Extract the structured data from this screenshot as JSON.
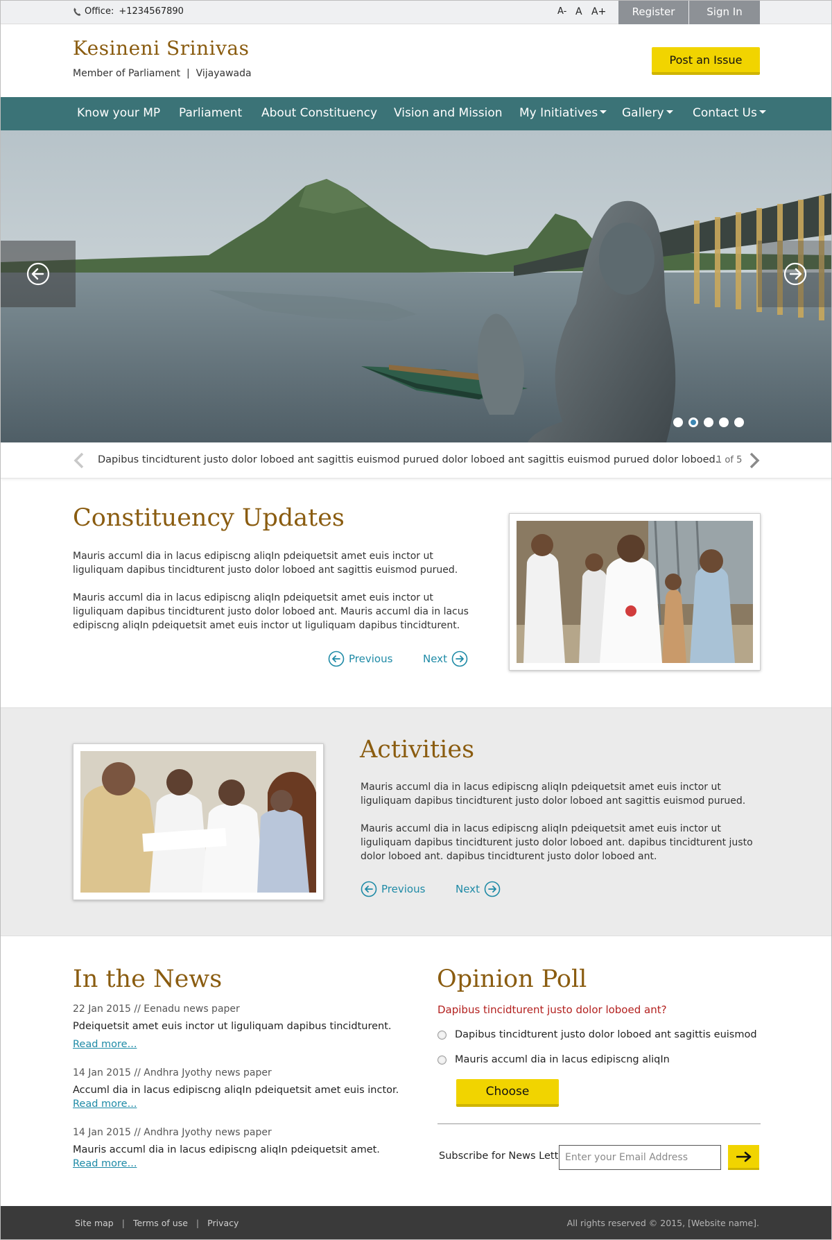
{
  "topbar": {
    "office_label": "Office:",
    "office_phone": "+1234567890",
    "font_decrease": "A-",
    "font_normal": "A",
    "font_increase": "A+",
    "register": "Register",
    "sign_in": "Sign In"
  },
  "header": {
    "title": "Kesineni Srinivas",
    "subtitle": "Member of Parliament  |  Vijayawada",
    "post_issue": "Post an Issue"
  },
  "nav": {
    "items": [
      {
        "label": "Know your MP",
        "dropdown": false
      },
      {
        "label": "Parliament",
        "dropdown": false
      },
      {
        "label": "About Constituency",
        "dropdown": false
      },
      {
        "label": "Vision and Mission",
        "dropdown": false
      },
      {
        "label": "My Initiatives",
        "dropdown": true
      },
      {
        "label": "Gallery",
        "dropdown": true
      },
      {
        "label": "Contact Us",
        "dropdown": true
      }
    ]
  },
  "slider": {
    "slide_count": 5,
    "active_slide": 2,
    "caption": "Dapibus tincidturent justo dolor loboed ant sagittis euismod purued dolor loboed ant sagittis euismod purued dolor loboed.",
    "counter": "1 of 5"
  },
  "updates": {
    "title": "Constituency Updates",
    "para1": "Mauris accuml dia in lacus edipiscng aliqIn pdeiquetsit amet euis inctor ut liguliquam dapibus tincidturent justo dolor loboed ant sagittis euismod purued.",
    "para2": "Mauris accuml dia in lacus edipiscng aliqIn pdeiquetsit amet euis inctor ut liguliquam dapibus tincidturent justo dolor loboed ant. Mauris accuml dia in lacus edipiscng aliqIn pdeiquetsit amet euis inctor ut liguliquam dapibus tincidturent.",
    "previous": "Previous",
    "next": "Next"
  },
  "activities": {
    "title": "Activities",
    "para1": "Mauris accuml dia in lacus edipiscng aliqIn pdeiquetsit amet euis inctor ut liguliquam dapibus tincidturent justo dolor loboed ant sagittis euismod purued.",
    "para2": "Mauris accuml dia in lacus edipiscng aliqIn pdeiquetsit amet euis inctor ut liguliquam dapibus tincidturent justo dolor loboed ant. dapibus tincidturent justo dolor loboed ant. dapibus tincidturent justo dolor loboed ant.",
    "previous": "Previous",
    "next": "Next"
  },
  "news": {
    "title": "In the News",
    "items": [
      {
        "meta": "22 Jan 2015 // Eenadu news paper",
        "text": "Pdeiquetsit amet euis inctor ut liguliquam dapibus tincidturent.",
        "link": "Read more..."
      },
      {
        "meta": "14 Jan 2015 // Andhra Jyothy news paper",
        "text": "Accuml dia in lacus edipiscng aliqIn pdeiquetsit amet euis inctor.",
        "link": "Read more..."
      },
      {
        "meta": "14 Jan 2015 // Andhra Jyothy news paper",
        "text": "Mauris accuml dia in lacus edipiscng aliqIn pdeiquetsit amet.",
        "link": "Read more..."
      }
    ]
  },
  "poll": {
    "title": "Opinion Poll",
    "question": "Dapibus tincidturent justo dolor loboed ant?",
    "options": [
      "Dapibus tincidturent justo dolor loboed ant sagittis euismod",
      "Mauris accuml dia in lacus edipiscng aliqIn"
    ],
    "choose": "Choose"
  },
  "newsletter": {
    "label": "Subscribe for News Letter",
    "placeholder": "Enter your Email Address"
  },
  "footer": {
    "links": [
      "Site map",
      "Terms of use",
      "Privacy"
    ],
    "copyright": "All rights reserved © 2015, [Website name]."
  },
  "colors": {
    "accent_gold": "#8a5c10",
    "nav_teal": "#3b7377",
    "button_yellow": "#f1d400",
    "link_blue": "#1e8aa6",
    "poll_red": "#b3201e",
    "footer_dark": "#3a3a3a"
  },
  "icons": {
    "phone": "phone-icon",
    "slider_prev": "arrow-left-circle-icon",
    "slider_next": "arrow-right-circle-icon",
    "caption_prev": "chevron-left-icon",
    "caption_next": "chevron-right-icon",
    "submit": "arrow-right-icon"
  }
}
